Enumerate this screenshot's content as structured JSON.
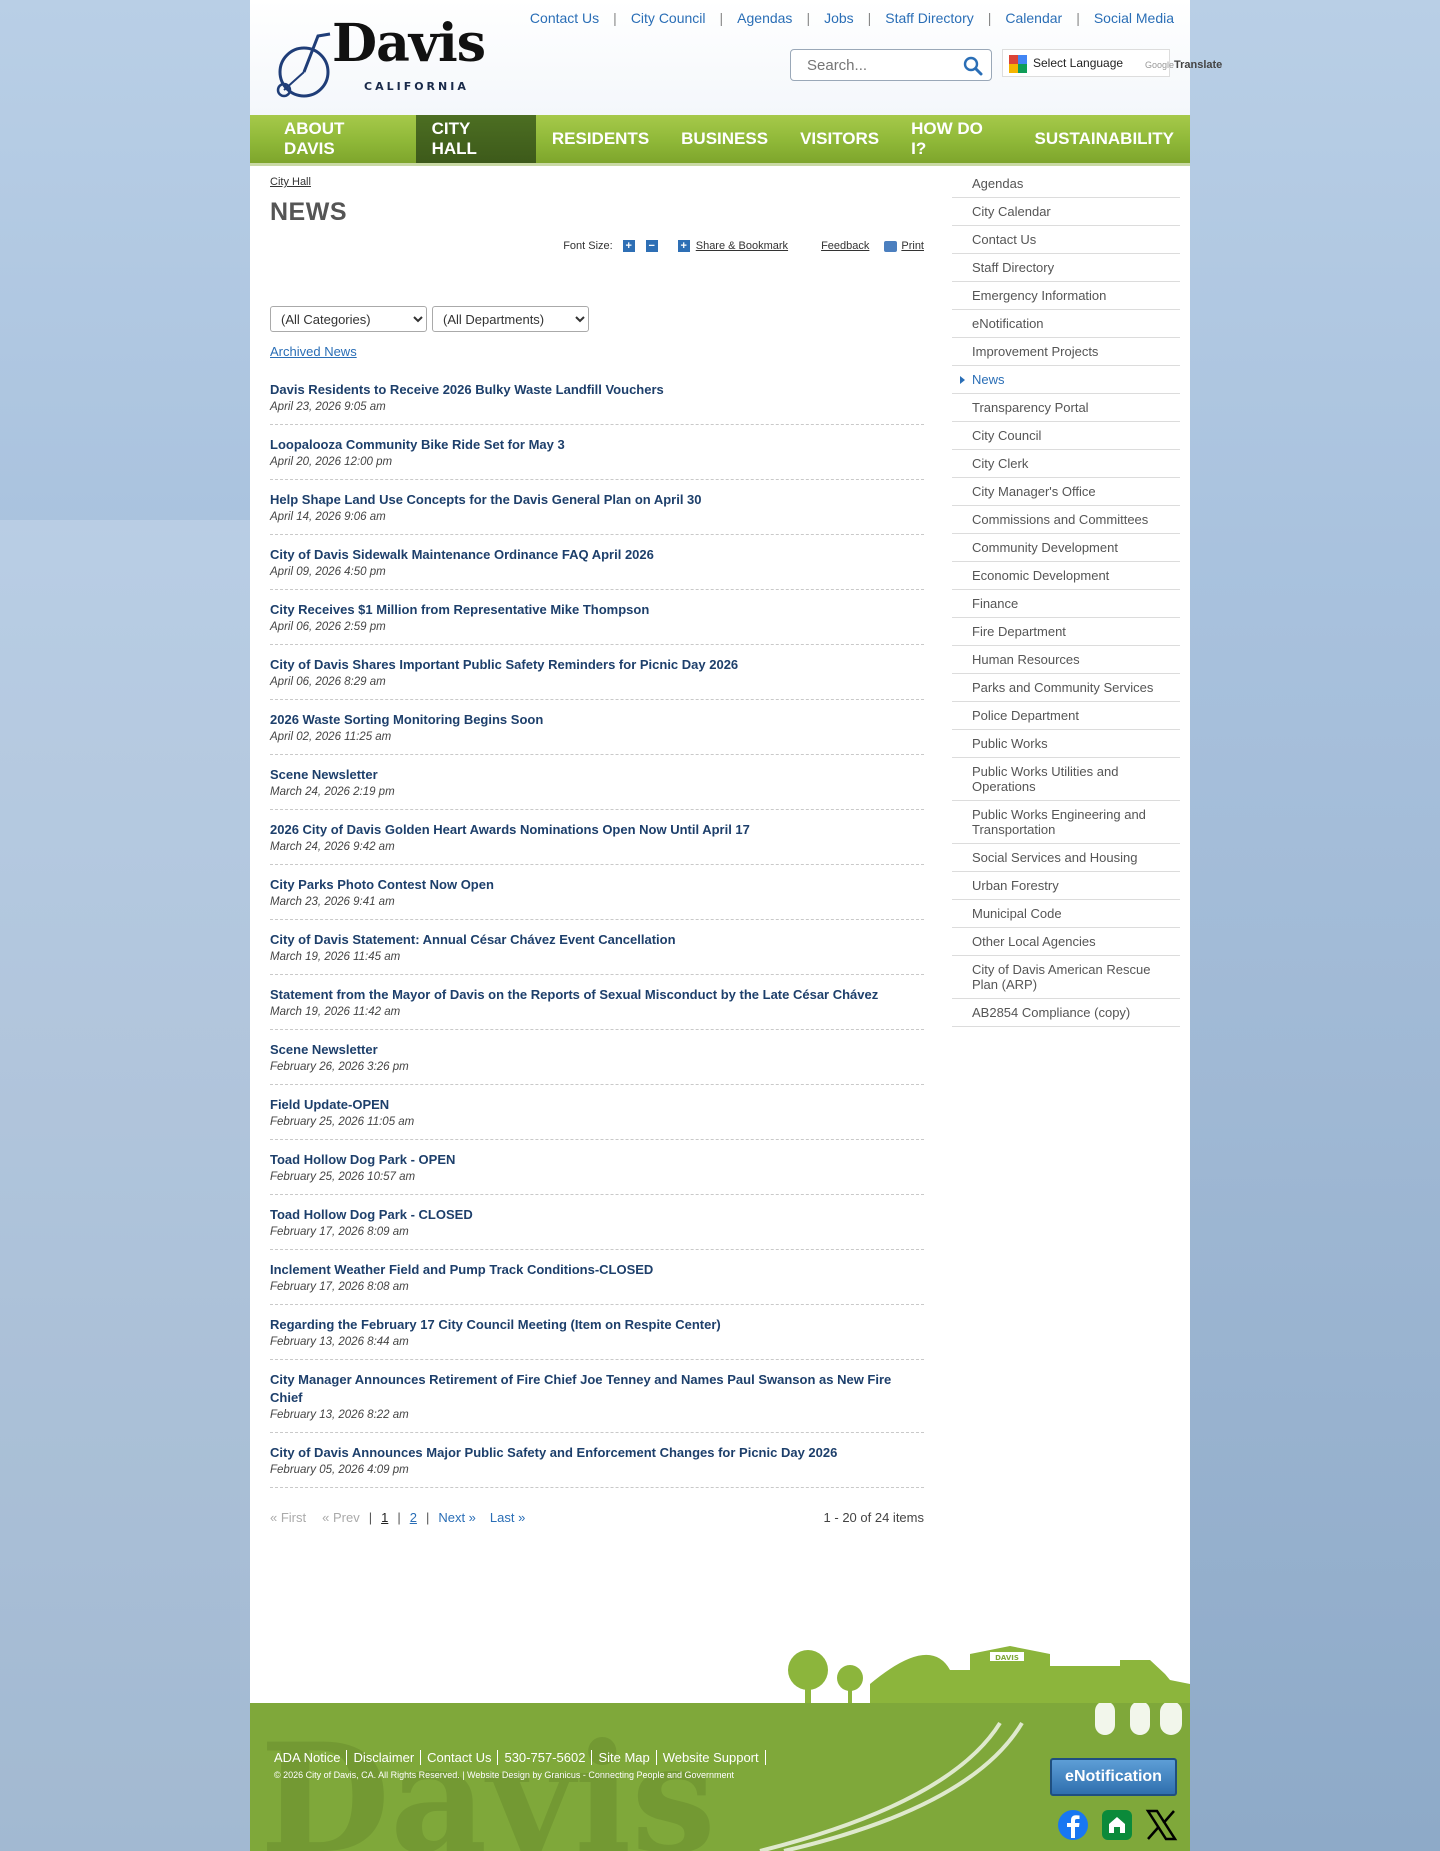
{
  "top_links": [
    "Contact Us",
    "City Council",
    "Agendas",
    "Jobs",
    "Staff Directory",
    "Calendar",
    "Social Media"
  ],
  "logo": {
    "word": "Davis",
    "sub": "CALIFORNIA"
  },
  "search": {
    "placeholder": "Search..."
  },
  "translate": {
    "label": "Select Language",
    "brand": "Google",
    "word": "Translate"
  },
  "nav": [
    {
      "label": "ABOUT DAVIS",
      "active": false
    },
    {
      "label": "CITY HALL",
      "active": true
    },
    {
      "label": "RESIDENTS",
      "active": false
    },
    {
      "label": "BUSINESS",
      "active": false
    },
    {
      "label": "VISITORS",
      "active": false
    },
    {
      "label": "HOW DO I?",
      "active": false
    },
    {
      "label": "SUSTAINABILITY",
      "active": false
    }
  ],
  "breadcrumb": "City Hall",
  "page_title": "NEWS",
  "tools": {
    "font_size": "Font Size:",
    "share": "Share & Bookmark",
    "feedback": "Feedback",
    "print": "Print"
  },
  "filters": {
    "categories": "(All Categories)",
    "departments": "(All Departments)"
  },
  "archived": "Archived News",
  "news": [
    {
      "title": "Davis Residents to Receive 2026 Bulky Waste Landfill Vouchers",
      "date": "April 23, 2026 9:05 am"
    },
    {
      "title": "Loopalooza Community Bike Ride Set for May 3",
      "date": "April 20, 2026 12:00 pm"
    },
    {
      "title": "Help Shape Land Use Concepts for the Davis General Plan on April 30",
      "date": "April 14, 2026 9:06 am"
    },
    {
      "title": "City of Davis Sidewalk Maintenance Ordinance FAQ April 2026",
      "date": "April 09, 2026 4:50 pm"
    },
    {
      "title": "City Receives $1 Million from Representative Mike Thompson",
      "date": "April 06, 2026 2:59 pm"
    },
    {
      "title": "City of Davis Shares Important Public Safety Reminders for Picnic Day 2026",
      "date": "April 06, 2026 8:29 am"
    },
    {
      "title": "2026 Waste Sorting Monitoring Begins Soon",
      "date": "April 02, 2026 11:25 am"
    },
    {
      "title": "Scene Newsletter",
      "date": "March 24, 2026 2:19 pm"
    },
    {
      "title": "2026 City of Davis Golden Heart Awards Nominations Open Now Until April 17",
      "date": "March 24, 2026 9:42 am"
    },
    {
      "title": "City Parks Photo Contest Now Open",
      "date": "March 23, 2026 9:41 am"
    },
    {
      "title": "City of Davis Statement: Annual César Chávez Event Cancellation",
      "date": "March 19, 2026 11:45 am"
    },
    {
      "title": "Statement from the Mayor of Davis on the Reports of Sexual Misconduct by the Late César Chávez",
      "date": "March 19, 2026 11:42 am"
    },
    {
      "title": "Scene Newsletter",
      "date": "February 26, 2026 3:26 pm"
    },
    {
      "title": "Field Update-OPEN",
      "date": "February 25, 2026 11:05 am"
    },
    {
      "title": "Toad Hollow Dog Park - OPEN",
      "date": "February 25, 2026 10:57 am"
    },
    {
      "title": "Toad Hollow Dog Park - CLOSED",
      "date": "February 17, 2026 8:09 am"
    },
    {
      "title": "Inclement Weather Field and Pump Track Conditions-CLOSED",
      "date": "February 17, 2026 8:08 am"
    },
    {
      "title": "Regarding the February 17 City Council Meeting (Item on Respite Center)",
      "date": "February 13, 2026 8:44 am"
    },
    {
      "title": "City Manager Announces Retirement of Fire Chief Joe Tenney and Names Paul Swanson as New Fire Chief",
      "date": "February 13, 2026 8:22 am"
    },
    {
      "title": "City of Davis Announces Major Public Safety and Enforcement Changes for Picnic Day 2026",
      "date": "February 05, 2026 4:09 pm"
    }
  ],
  "pager": {
    "first": "« First",
    "prev": "« Prev",
    "page1": "1",
    "page2": "2",
    "next": "Next »",
    "last": "Last »",
    "count": "1 - 20 of 24 items"
  },
  "sidebar": [
    {
      "label": "Agendas",
      "active": false
    },
    {
      "label": "City Calendar",
      "active": false
    },
    {
      "label": "Contact Us",
      "active": false
    },
    {
      "label": "Staff Directory",
      "active": false
    },
    {
      "label": "Emergency Information",
      "active": false
    },
    {
      "label": "eNotification",
      "active": false
    },
    {
      "label": "Improvement Projects",
      "active": false
    },
    {
      "label": "News",
      "active": true
    },
    {
      "label": "Transparency Portal",
      "active": false
    },
    {
      "label": "City Council",
      "active": false
    },
    {
      "label": "City Clerk",
      "active": false
    },
    {
      "label": "City Manager's Office",
      "active": false
    },
    {
      "label": "Commissions and Committees",
      "active": false
    },
    {
      "label": "Community Development",
      "active": false
    },
    {
      "label": "Economic Development",
      "active": false
    },
    {
      "label": "Finance",
      "active": false
    },
    {
      "label": "Fire Department",
      "active": false
    },
    {
      "label": "Human Resources",
      "active": false
    },
    {
      "label": "Parks and Community Services",
      "active": false
    },
    {
      "label": "Police Department",
      "active": false
    },
    {
      "label": "Public Works",
      "active": false
    },
    {
      "label": "Public Works Utilities and Operations",
      "active": false
    },
    {
      "label": "Public Works Engineering and Transportation",
      "active": false
    },
    {
      "label": "Social Services and Housing",
      "active": false
    },
    {
      "label": "Urban Forestry",
      "active": false
    },
    {
      "label": "Municipal Code",
      "active": false
    },
    {
      "label": "Other Local Agencies",
      "active": false
    },
    {
      "label": "City of Davis American Rescue Plan (ARP)",
      "active": false
    },
    {
      "label": "AB2854 Compliance (copy)",
      "active": false
    }
  ],
  "footer": {
    "links": [
      "ADA Notice",
      "Disclaimer",
      "Contact Us",
      "530-757-5602",
      "Site Map",
      "Website Support"
    ],
    "copyright": "© 2026 City of Davis, CA. All Rights Reserved. | Website Design by Granicus - Connecting People and Government",
    "enotification": "eNotification",
    "watermark": "Davis",
    "station_sign": "DAVIS"
  },
  "social": [
    "facebook-icon",
    "nextdoor-icon",
    "x-icon"
  ],
  "colors": {
    "nav_green": "#8fb838",
    "nav_active": "#3d5a1a",
    "link_blue": "#2a6eb6",
    "news_title": "#1d3f6b",
    "footer_green": "#7fa83a"
  }
}
